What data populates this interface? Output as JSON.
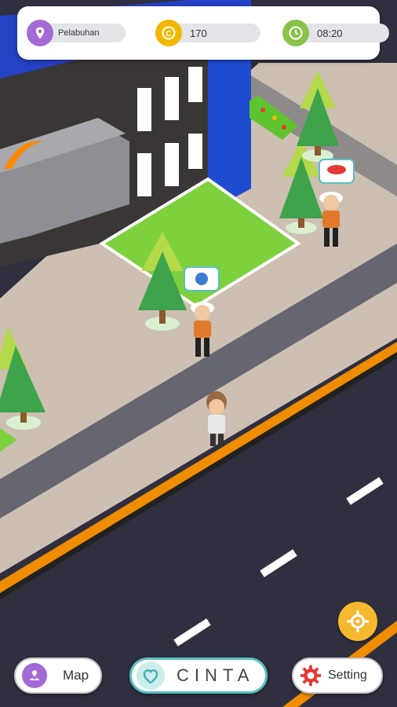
{
  "hud": {
    "location": "Pelabuhan",
    "coins": "170",
    "time": "08:20"
  },
  "buttons": {
    "map": "Map",
    "cinta": "CINTA",
    "setting": "Setting"
  },
  "icons": {
    "location": "location-pin-icon",
    "coin": "coin-icon",
    "clock": "clock-icon",
    "map": "map-icon",
    "heart": "heart-icon",
    "gear": "gear-icon",
    "target": "crosshair-icon"
  },
  "colors": {
    "purple": "#a36ad6",
    "gold": "#f2b800",
    "green": "#8bc34a",
    "teal": "#5ac0c3",
    "red": "#e53935",
    "orange": "#f6b82e"
  }
}
